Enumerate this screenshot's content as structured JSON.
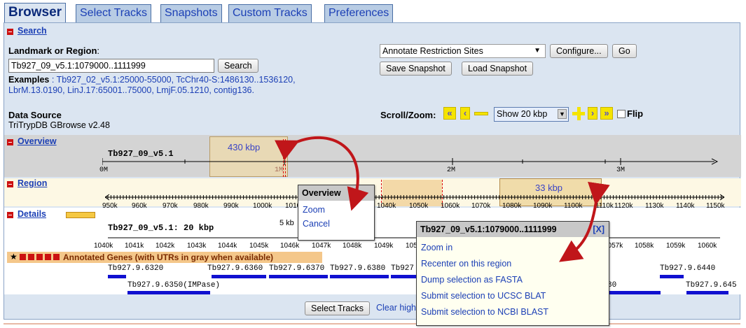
{
  "tabs": [
    {
      "label": "Browser"
    },
    {
      "label": "Select Tracks"
    },
    {
      "label": "Snapshots"
    },
    {
      "label": "Custom Tracks"
    },
    {
      "label": "Preferences"
    }
  ],
  "search": {
    "section_label": "Search",
    "landmark_label": "Landmark or Region",
    "landmark_suffix": ":",
    "landmark_value": "Tb927_09_v5.1:1079000..1111999",
    "search_button": "Search",
    "examples_label": "Examples",
    "examples_sep": " : ",
    "examples_line1": "Tb927_02_v5.1:25000-55000, TcChr40-S:1486130..1536120,",
    "examples_line2": "LbrM.13.0190, LinJ.17:65001..75000, LmjF.05.1210, contig136."
  },
  "annotate": {
    "select_value": "Annotate Restriction Sites",
    "configure_button": "Configure...",
    "go_button": "Go",
    "save_snapshot": "Save Snapshot",
    "load_snapshot": "Load Snapshot"
  },
  "data_source": {
    "label": "Data Source",
    "value": "TriTrypDB GBrowse v2.48"
  },
  "scroll_zoom": {
    "label": "Scroll/Zoom:",
    "show_value": "Show 20 kbp",
    "flip_label": "Flip",
    "btn_far_left": "«",
    "btn_left": "‹",
    "btn_right": "›",
    "btn_far_right": "»",
    "btn_zoom_in": "+"
  },
  "overview": {
    "section_label": "Overview",
    "chrom": "Tb927_09_v5.1",
    "size_label": "430 kbp",
    "ticks": [
      "0M",
      "1M",
      "2M",
      "3M"
    ]
  },
  "region": {
    "section_label": "Region",
    "size_label": "33 kbp",
    "ticks": [
      "950k",
      "960k",
      "970k",
      "980k",
      "990k",
      "1000k",
      "1010k",
      "1040k",
      "1050k",
      "1060k",
      "1070k",
      "1080k",
      "1090k",
      "1100k",
      "1110k",
      "1120k",
      "1130k",
      "1140k",
      "1150k"
    ]
  },
  "details": {
    "section_label": "Details",
    "title": "Tb927_09_v5.1: 20 kbp",
    "scale": "5 kb",
    "ticks": [
      "1040k",
      "1041k",
      "1042k",
      "1043k",
      "1044k",
      "1045k",
      "1046k",
      "1047k",
      "1048k",
      "1049k",
      "1050",
      "1057k",
      "1058k",
      "1059k",
      "1060k"
    ],
    "genes_track_label": "Annotated Genes (with UTRs in gray when available)",
    "genes": [
      "Tb927.9.6320",
      "Tb927.9.6350(IMPase)",
      "Tb927.9.6360",
      "Tb927.9.6370",
      "Tb927.9.6380",
      "Tb927",
      "Tb927.9.6440",
      "Tb927.9.645",
      "80"
    ]
  },
  "bottom": {
    "select_tracks": "Select Tracks",
    "clear_link": "Clear high"
  },
  "overview_menu": {
    "title": "Overview",
    "items": [
      "Zoom",
      "Cancel"
    ]
  },
  "region_menu": {
    "title": "Tb927_09_v5.1:1079000..1111999",
    "close": "[X]",
    "items": [
      "Zoom in",
      "Recenter on this region",
      "Dump selection as FASTA",
      "Submit selection to UCSC BLAT",
      "Submit selection to NCBI BLAST"
    ]
  },
  "colors": {
    "panel_bg": "#dbe5f1",
    "tab_bg": "#b8cce4",
    "link": "#1b3fb5",
    "annotation_arrow": "#c0161a",
    "highlight": "#f3d9a8",
    "gene": "#1010d0"
  }
}
